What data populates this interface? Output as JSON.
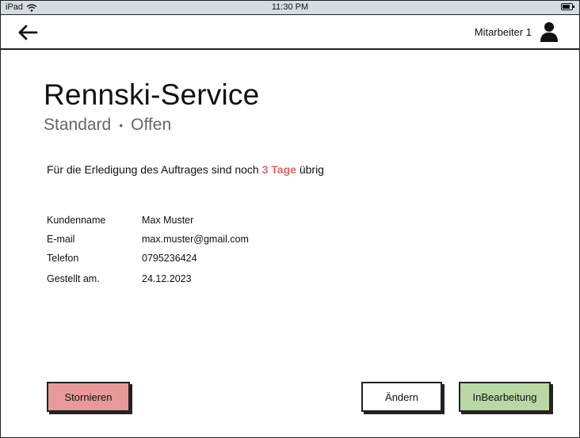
{
  "status_bar": {
    "device": "iPad",
    "time": "11:30 PM"
  },
  "header": {
    "user_label": "Mitarbeiter 1"
  },
  "order": {
    "title": "Rennski-Service",
    "priority": "Standard",
    "separator": "•",
    "status": "Offen"
  },
  "notice": {
    "prefix": "Für die Erledigung des Auftrages sind noch",
    "days": "3 Tage",
    "suffix": "übrig"
  },
  "customer": {
    "rows": [
      {
        "label": "Kundenname",
        "value": "Max Muster"
      },
      {
        "label": "E-mail",
        "value": "max.muster@gmail.com"
      },
      {
        "label": "Telefon",
        "value": "0795236424"
      },
      {
        "label": "Gestellt am.",
        "value": "24.12.2023"
      }
    ]
  },
  "actions": {
    "cancel": "Stornieren",
    "edit": "Ändern",
    "in_progress": "InBearbeitung"
  },
  "colors": {
    "accent_days": "#e06666",
    "cancel_bg": "#e89a9a",
    "progress_bg": "#b8d8a4",
    "statusbar_bg": "#d6dde2"
  },
  "icons": {
    "wifi": "wifi-icon",
    "battery": "battery-icon",
    "back": "arrow-left-icon",
    "user": "user-icon"
  }
}
